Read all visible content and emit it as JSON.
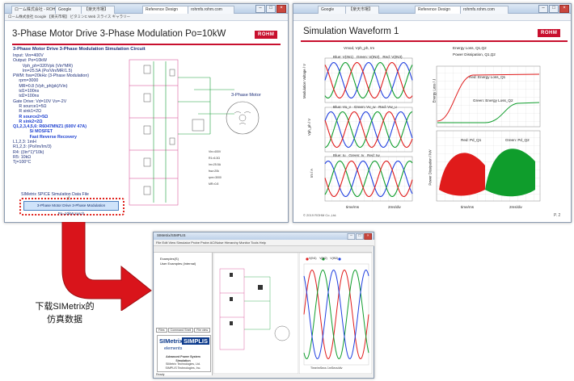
{
  "left_window": {
    "tabs": [
      "ローム株式会社 - ROHM",
      "Google",
      "【楽天市場】",
      "Reference Design",
      "rohmfs.rohm.com"
    ],
    "menu": "ローム株式会社  Google  【楽天市場】 ビタミンC  Web スライス ギャラリー",
    "slide_title": "3-Phase Motor Drive 3-Phase Modulation Po=10kW",
    "brand": "ROHM",
    "section_title": "3-Phase Motor Drive 3-Phase Modulation  Simulation Circuit",
    "params": [
      "Input: Vin=400V",
      "",
      "Output: Po=10kW",
      "        Vph_ph=320Vpk (Vin*MR)",
      "        Im=25.5A (Po/Vin/MR/1.5)",
      "",
      "PWM: fsw=20kHz (3-Phase Modulation)",
      "     rpm=3000",
      "     MR=0.8 (Vph_ph(pk)/Vin)",
      "     td1=100ns",
      "     td2=100ns",
      "",
      "Gate Drive: Vd=10V Vs=-2V",
      "     R source1=5Ω",
      "     R sink1=2Ω"
    ],
    "params_blue": [
      "     R source2=5Ω",
      "     R sink2=2Ω",
      "",
      "Q1,2,3,4,5,6: R6047MNZ1 (600V 47A)",
      "              Si MOSFET",
      "              Fast Reverse Recovery"
    ],
    "params_tail": [
      "L1,2,3: 1mH",
      "",
      "R1,2,3: (Po/Im/Im/3)",
      "R4: ((Iin^1)*10k)",
      "R5: 10kΩ",
      "",
      "Tj=100°C"
    ],
    "spice_label": "SIMetrix SPICE Simulation Data File",
    "download_button": "3-Phase Motor Drive 3-Phase Modulation Po=10kW.sxsch",
    "motor_label": "3-Phase Motor",
    "page": ""
  },
  "right_window": {
    "tabs": [
      "Google",
      "【楽天市場】",
      "Reference Design",
      "rohmfs.rohm.com"
    ],
    "slide_title": "Simulation Waveform 1",
    "brand": "ROHM",
    "page": "P. 2",
    "copyright": "© 2019 ROHM Co.,Ltd.",
    "plots": [
      {
        "title": "Vmod, Vph_ph, Im",
        "ylabel": "Modulation Voltage / V",
        "legend": [
          "Blue: V(IN1)",
          "Green: V(IN2)",
          "Red: V(IN3)"
        ]
      },
      {
        "ylabel": "Vph_ph / V",
        "legend": [
          "Blue: Vu_v",
          "Green: Vv_w",
          "Red: Vw_u"
        ]
      },
      {
        "ylabel": "Im / A",
        "legend": [
          "Blue: Iu",
          "Green: Iv",
          "Red: Iw"
        ],
        "xlabel": "time/ms",
        "xdiv": "2ms/div"
      },
      {
        "title": "Energy Loss, Q1,Q2",
        "ylabel": "Energy Loss / J",
        "legend": [
          "Red: Energy Loss_Q1",
          "Green: Energy Loss_Q2"
        ]
      },
      {
        "title": "Power Dissipation, Q1,Q2",
        "ylabel": "Power Dissipation / kW",
        "legend": [
          "Red: Pd_Q1",
          "Green: Pd_Q2"
        ],
        "xlabel": "time/ms",
        "xdiv": "2ms/div"
      }
    ]
  },
  "caption": [
    "下载SIMetrix的",
    "仿真数据"
  ],
  "simetrix_window": {
    "title": "SIMetrix/SIMPLIS",
    "menu": "File  Edit  View  Simulator  Probe  Probe AC/Noise  Hierarchy  Monitor  Tools  Help",
    "tree_items": [
      "Examples(S)",
      "User Examples (Internal)"
    ],
    "bottom_tabs": [
      "Files",
      "Command Shell",
      "File view"
    ],
    "logo_main": "SIMetrix",
    "logo_side": "SIMPLIS",
    "logo_elements": "elements",
    "logo_sub": [
      "Advanced Power System Simulation",
      "SIMetrix Technologies, Ltd.",
      "SIMPLIS Technologies, Inc."
    ],
    "plot_legends": [
      "V(IN1)",
      "V(IN2)",
      "V(IN3)"
    ],
    "plot_xlabel": "Time/mSecs  1mSecs/div",
    "status": "Ready"
  },
  "colors": {
    "brand_red": "#c8102e",
    "series_blue": "#1f3fe0",
    "series_green": "#0f9d2c",
    "series_red": "#e01b1b",
    "arrow_red": "#d9141b"
  }
}
